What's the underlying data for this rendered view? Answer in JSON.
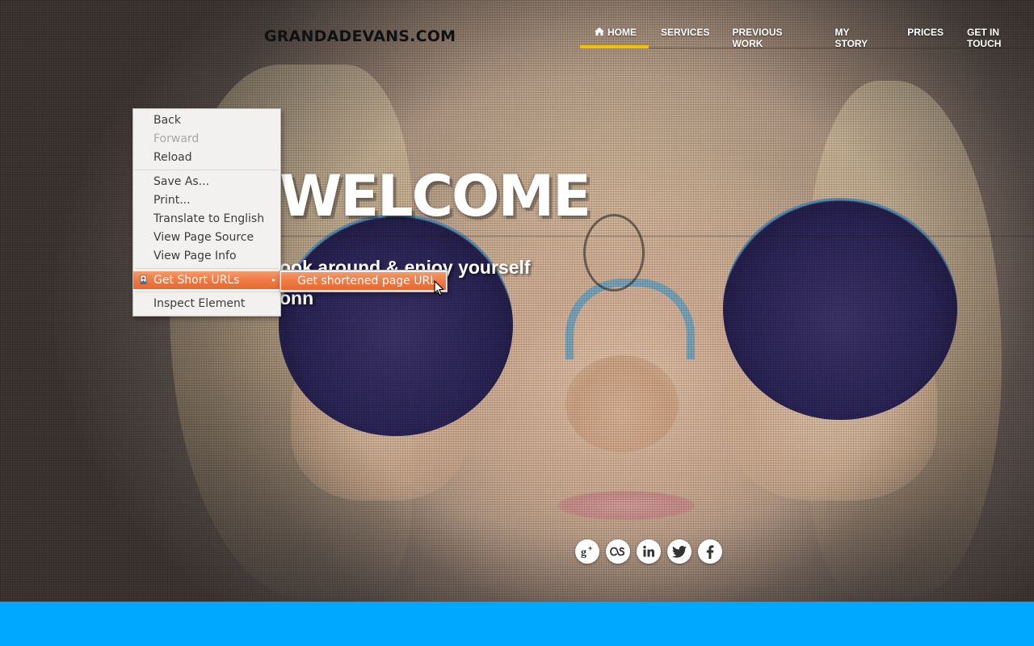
{
  "site": {
    "logo": "GRANDADEVANS.COM"
  },
  "nav": {
    "items": [
      {
        "label": "HOME",
        "icon": "home-icon",
        "active": true
      },
      {
        "label": "SERVICES"
      },
      {
        "label": "PREVIOUS WORK"
      },
      {
        "label": "MY STORY"
      },
      {
        "label": "PRICES"
      },
      {
        "label": "GET IN TOUCH"
      }
    ],
    "active_color": "#f2c200"
  },
  "hero": {
    "heading": "WELCOME",
    "tagline": "ook around & enjoy yourself",
    "tagline_line2": "onn"
  },
  "social": {
    "icons": [
      "google-plus-icon",
      "lastfm-icon",
      "linkedin-icon",
      "twitter-icon",
      "facebook-icon"
    ]
  },
  "context_menu": {
    "items": [
      {
        "label": "Back"
      },
      {
        "label": "Forward",
        "disabled": true
      },
      {
        "label": "Reload"
      },
      {
        "label": "Save As..."
      },
      {
        "label": "Print..."
      },
      {
        "label": "Translate to English"
      },
      {
        "label": "View Page Source"
      },
      {
        "label": "View Page Info"
      },
      {
        "label": "Get Short URLs",
        "submenu": true,
        "highlighted": true
      },
      {
        "label": "Inspect Element"
      }
    ],
    "submenu": {
      "items": [
        {
          "label": "Get shortened page URL"
        }
      ]
    },
    "highlight_color": "#ef7a45"
  },
  "footer": {
    "bar_color": "#00a9ff"
  }
}
